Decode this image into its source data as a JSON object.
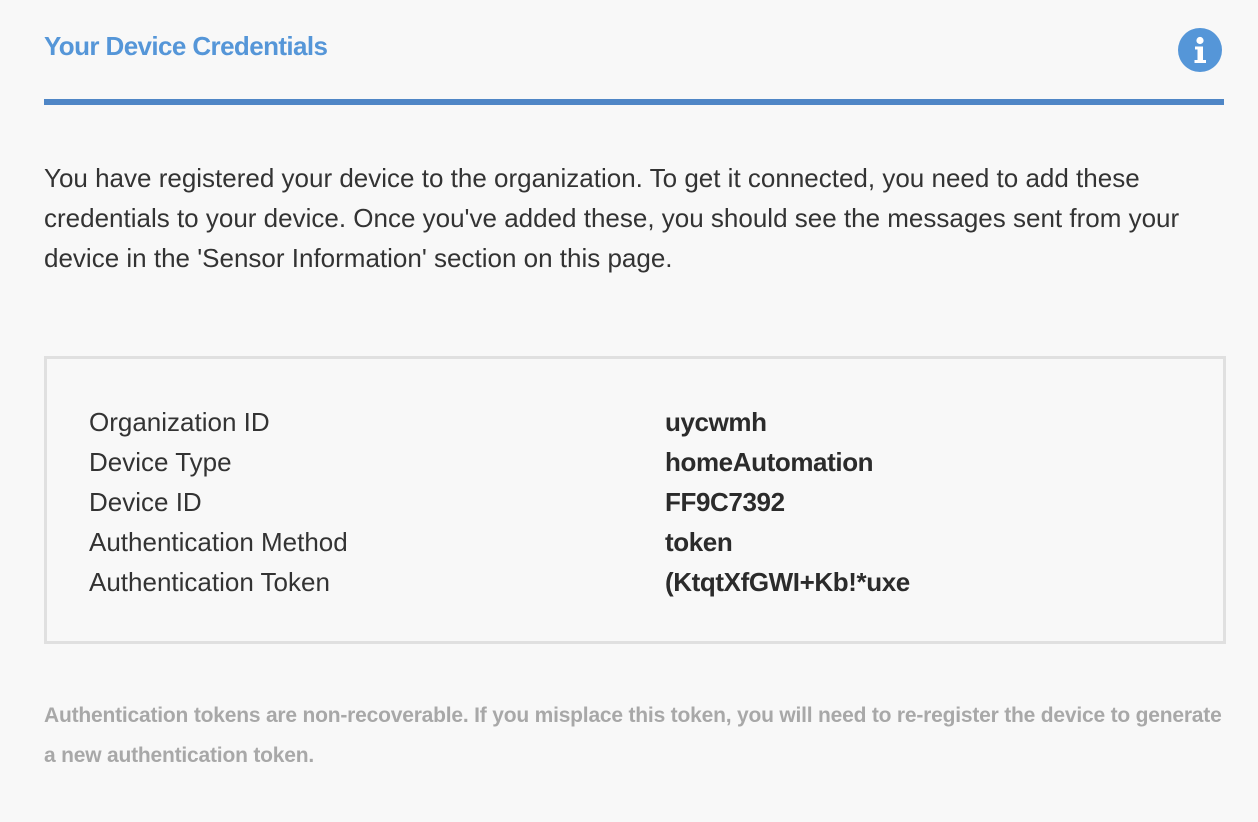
{
  "header": {
    "title": "Your Device Credentials",
    "info_icon": "info-icon",
    "accent_color": "#5596d8"
  },
  "intro": {
    "text": "You have registered your device to the organization. To get it connected, you need to add these credentials to your device. Once you've added these, you should see the messages sent from your device in the 'Sensor Information' section on this page."
  },
  "credentials": [
    {
      "label": "Organization ID",
      "value": "uycwmh"
    },
    {
      "label": "Device Type",
      "value": "homeAutomation"
    },
    {
      "label": "Device ID",
      "value": "FF9C7392"
    },
    {
      "label": "Authentication Method",
      "value": "token"
    },
    {
      "label": "Authentication Token",
      "value": "(KtqtXfGWI+Kb!*uxe"
    }
  ],
  "footnote": {
    "text": "Authentication tokens are non-recoverable. If you misplace this token, you will need to re-register the device to generate a new authentication token."
  }
}
